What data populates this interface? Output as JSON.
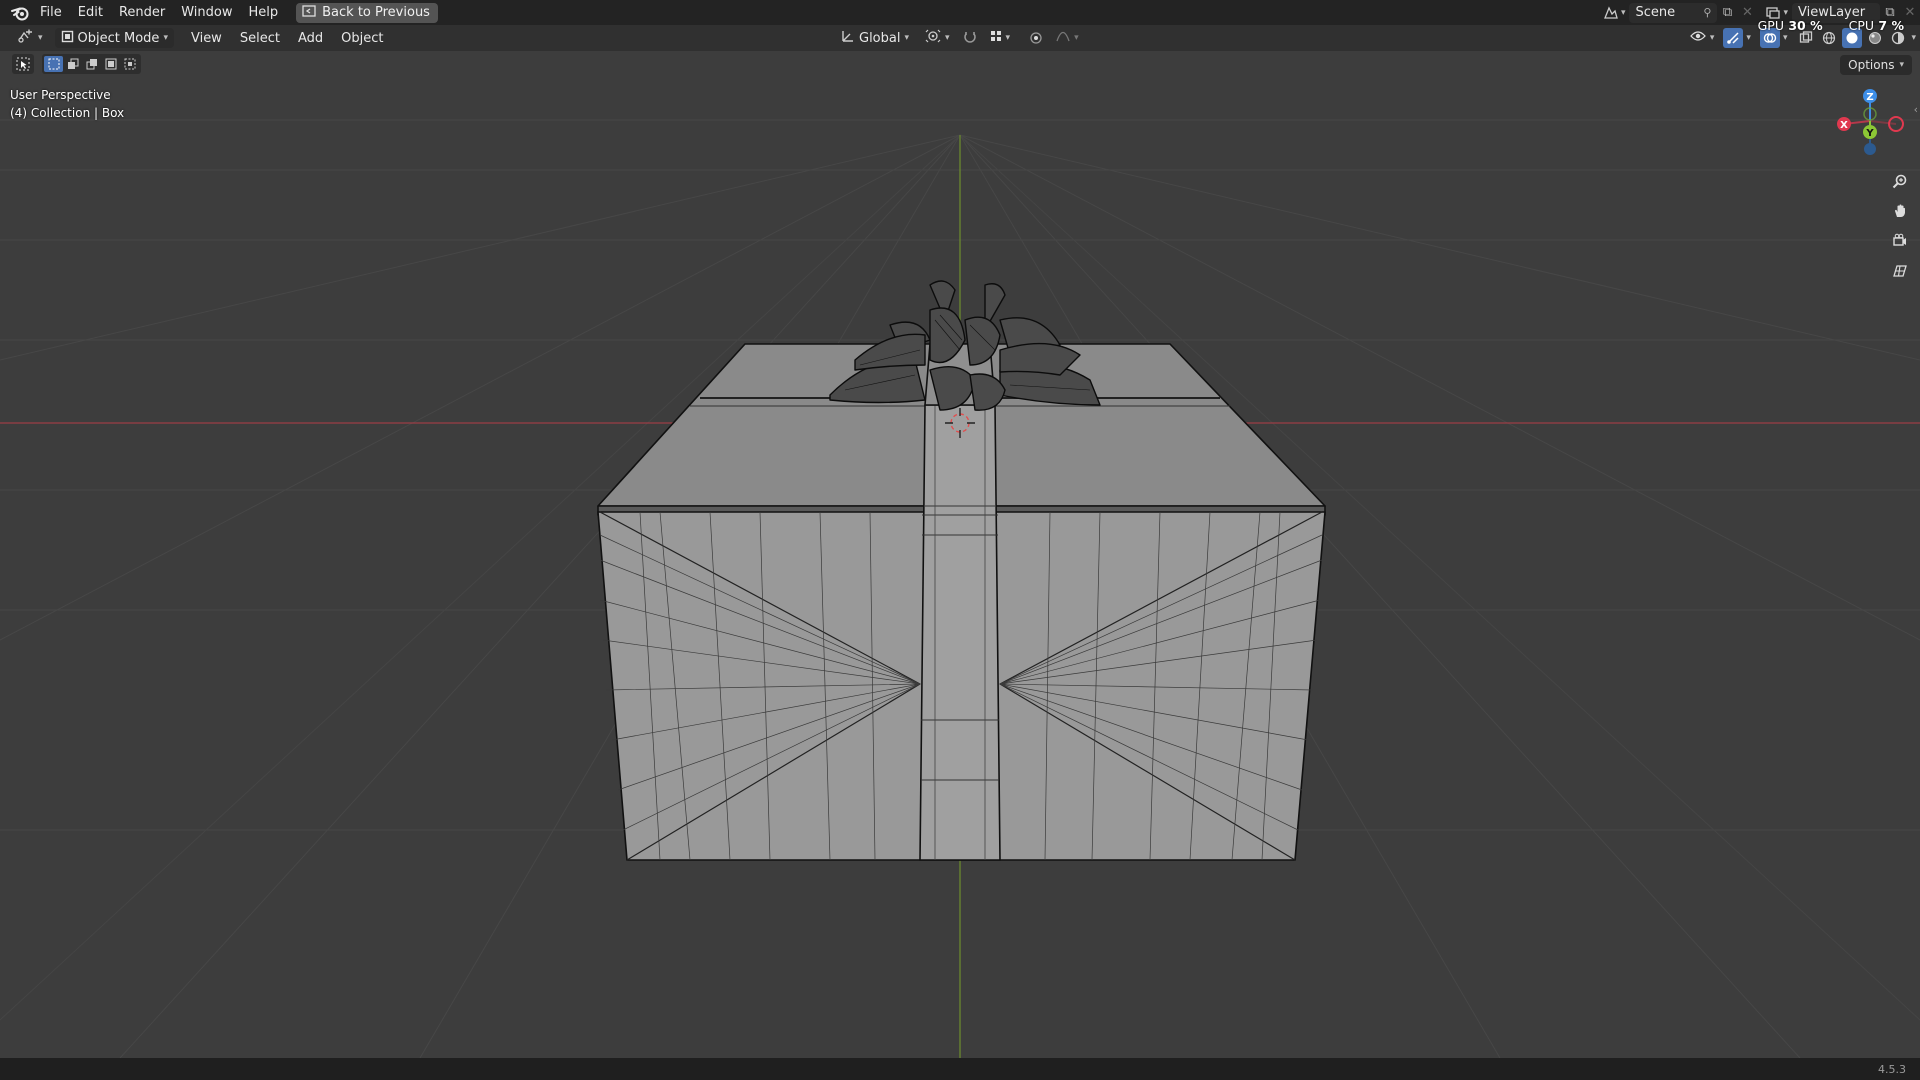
{
  "menu": {
    "items": [
      "File",
      "Edit",
      "Render",
      "Window",
      "Help"
    ],
    "back_label": "Back to Previous"
  },
  "topbar": {
    "scene_label": "Scene",
    "viewlayer_label": "ViewLayer"
  },
  "header": {
    "mode_label": "Object Mode",
    "view_label": "View",
    "select_label": "Select",
    "add_label": "Add",
    "object_label": "Object",
    "orientation_label": "Global"
  },
  "perf": {
    "gpu_label": "GPU",
    "gpu_value": "30 %",
    "cpu_label": "CPU",
    "cpu_value": "7 %"
  },
  "viewport": {
    "options_label": "Options",
    "perspective_label": "User Perspective",
    "collection_label": "(4) Collection | Box",
    "axis_x": "X",
    "axis_y": "Y",
    "axis_z": "Z"
  },
  "status": {
    "version": "4.5.3"
  },
  "colors": {
    "x_axis": "#e0394f",
    "y_axis": "#8cc735",
    "z_axis": "#3d8ee8",
    "accent": "#4772b3"
  }
}
